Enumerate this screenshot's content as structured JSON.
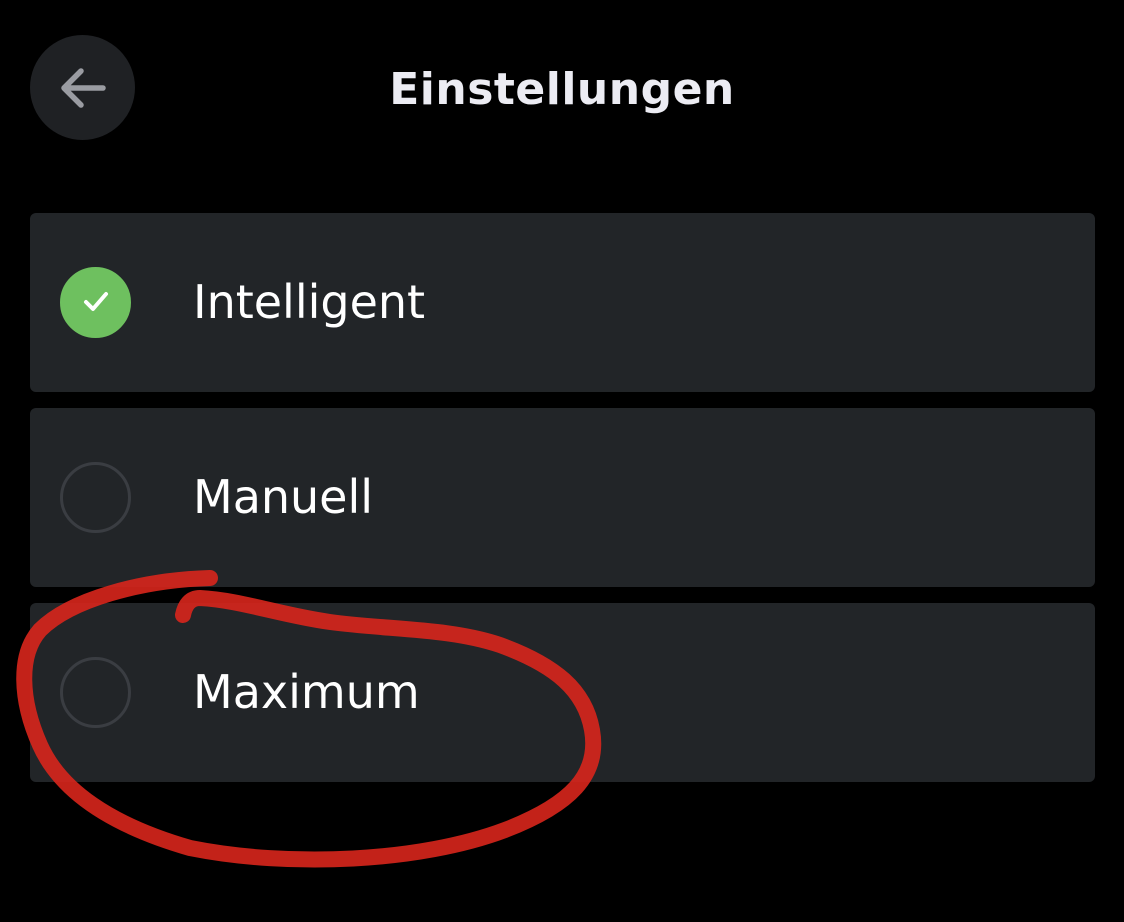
{
  "header": {
    "title": "Einstellungen",
    "back_icon": "arrow-left-icon"
  },
  "options": [
    {
      "label": "Intelligent",
      "selected": true
    },
    {
      "label": "Manuell",
      "selected": false
    },
    {
      "label": "Maximum",
      "selected": false
    }
  ],
  "colors": {
    "background": "#000000",
    "card": "#222528",
    "selected_accent": "#6ec05f",
    "annotation_marker": "#d8261c"
  }
}
